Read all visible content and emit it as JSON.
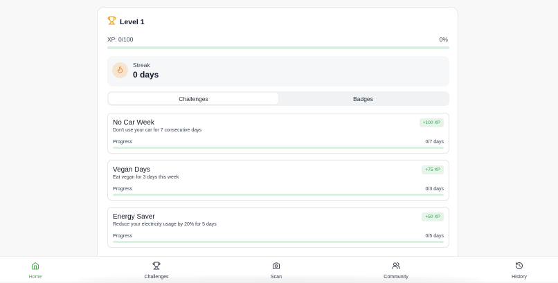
{
  "level": {
    "title": "Level 1",
    "xp_label": "XP: 0/100",
    "xp_percent": "0%",
    "xp_fraction": 0
  },
  "streak": {
    "label": "Streak",
    "value": "0 days"
  },
  "tabs": [
    {
      "label": "Challenges",
      "active": true
    },
    {
      "label": "Badges",
      "active": false
    }
  ],
  "challenges": [
    {
      "title": "No Car Week",
      "description": "Don't use your car for 7 consecutive days",
      "reward": "+100 XP",
      "progress_label": "Progress",
      "progress_value": "0/7 days",
      "progress_fraction": 0
    },
    {
      "title": "Vegan Days",
      "description": "Eat vegan for 3 days this week",
      "reward": "+75 XP",
      "progress_label": "Progress",
      "progress_value": "0/3 days",
      "progress_fraction": 0
    },
    {
      "title": "Energy Saver",
      "description": "Reduce your electricity usage by 20% for 5 days",
      "reward": "+50 XP",
      "progress_label": "Progress",
      "progress_value": "0/5 days",
      "progress_fraction": 0
    }
  ],
  "nav": [
    {
      "label": "Home",
      "icon": "home-icon",
      "active": true
    },
    {
      "label": "Challenges",
      "icon": "trophy-icon",
      "active": false
    },
    {
      "label": "Scan",
      "icon": "camera-icon",
      "active": false
    },
    {
      "label": "Community",
      "icon": "users-icon",
      "active": false
    },
    {
      "label": "History",
      "icon": "history-icon",
      "active": false
    }
  ],
  "colors": {
    "accent": "#4caf50",
    "trophy": "#e0a020",
    "flame": "#e28a3a",
    "badge_bg": "#e6f4ea"
  }
}
